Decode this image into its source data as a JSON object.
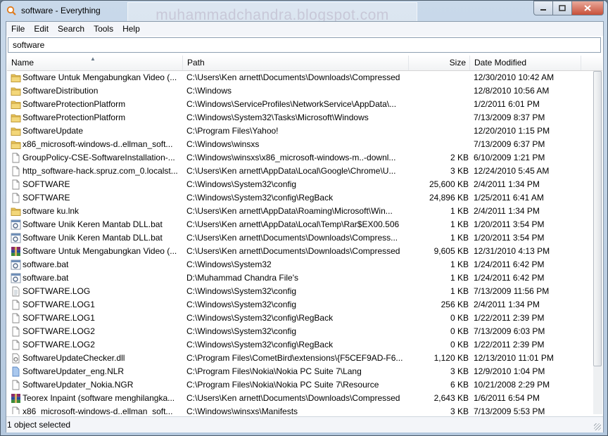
{
  "window": {
    "title": "software - Everything",
    "watermark": "muhammadchandra.blogspot.com",
    "controls": [
      "minimize",
      "maximize",
      "close"
    ]
  },
  "menu": [
    "File",
    "Edit",
    "Search",
    "Tools",
    "Help"
  ],
  "search": {
    "value": "software"
  },
  "columns": {
    "name": "Name",
    "path": "Path",
    "size": "Size",
    "date": "Date Modified"
  },
  "rows": [
    {
      "icon": "folder",
      "name": "Software Untuk Mengabungkan Video (...",
      "path": "C:\\Users\\Ken arnett\\Documents\\Downloads\\Compressed",
      "size": "",
      "date": "12/30/2010 10:42 AM"
    },
    {
      "icon": "folder",
      "name": "SoftwareDistribution",
      "path": "C:\\Windows",
      "size": "",
      "date": "12/8/2010 10:56 AM"
    },
    {
      "icon": "folder",
      "name": "SoftwareProtectionPlatform",
      "path": "C:\\Windows\\ServiceProfiles\\NetworkService\\AppData\\...",
      "size": "",
      "date": "1/2/2011 6:01 PM"
    },
    {
      "icon": "folder",
      "name": "SoftwareProtectionPlatform",
      "path": "C:\\Windows\\System32\\Tasks\\Microsoft\\Windows",
      "size": "",
      "date": "7/13/2009 8:37 PM"
    },
    {
      "icon": "folder",
      "name": "SoftwareUpdate",
      "path": "C:\\Program Files\\Yahoo!",
      "size": "",
      "date": "12/20/2010 1:15 PM"
    },
    {
      "icon": "folder",
      "name": "x86_microsoft-windows-d..ellman_soft...",
      "path": "C:\\Windows\\winsxs",
      "size": "",
      "date": "7/13/2009 6:37 PM"
    },
    {
      "icon": "file",
      "name": "GroupPolicy-CSE-SoftwareInstallation-...",
      "path": "C:\\Windows\\winsxs\\x86_microsoft-windows-m..-downl...",
      "size": "2 KB",
      "date": "6/10/2009 1:21 PM"
    },
    {
      "icon": "file",
      "name": "http_software-hack.spruz.com_0.localst...",
      "path": "C:\\Users\\Ken arnett\\AppData\\Local\\Google\\Chrome\\U...",
      "size": "3 KB",
      "date": "12/24/2010 5:45 AM"
    },
    {
      "icon": "file",
      "name": "SOFTWARE",
      "path": "C:\\Windows\\System32\\config",
      "size": "25,600 KB",
      "date": "2/4/2011 1:34 PM"
    },
    {
      "icon": "file",
      "name": "SOFTWARE",
      "path": "C:\\Windows\\System32\\config\\RegBack",
      "size": "24,896 KB",
      "date": "1/25/2011 6:41 AM"
    },
    {
      "icon": "folder",
      "name": "software ku.lnk",
      "path": "C:\\Users\\Ken arnett\\AppData\\Roaming\\Microsoft\\Win...",
      "size": "1 KB",
      "date": "2/4/2011 1:34 PM"
    },
    {
      "icon": "bat",
      "name": "Software Unik Keren Mantab DLL.bat",
      "path": "C:\\Users\\Ken arnett\\AppData\\Local\\Temp\\Rar$EX00.506",
      "size": "1 KB",
      "date": "1/20/2011 3:54 PM"
    },
    {
      "icon": "bat",
      "name": "Software Unik Keren Mantab DLL.bat",
      "path": "C:\\Users\\Ken arnett\\Documents\\Downloads\\Compress...",
      "size": "1 KB",
      "date": "1/20/2011 3:54 PM"
    },
    {
      "icon": "rar",
      "name": "Software Untuk Mengabungkan Video (...",
      "path": "C:\\Users\\Ken arnett\\Documents\\Downloads\\Compressed",
      "size": "9,605 KB",
      "date": "12/31/2010 4:13 PM"
    },
    {
      "icon": "bat",
      "name": "software.bat",
      "path": "C:\\Windows\\System32",
      "size": "1 KB",
      "date": "1/24/2011 6:42 PM"
    },
    {
      "icon": "bat",
      "name": "software.bat",
      "path": "D:\\Muhammad Chandra File's",
      "size": "1 KB",
      "date": "1/24/2011 6:42 PM"
    },
    {
      "icon": "text",
      "name": "SOFTWARE.LOG",
      "path": "C:\\Windows\\System32\\config",
      "size": "1 KB",
      "date": "7/13/2009 11:56 PM"
    },
    {
      "icon": "file",
      "name": "SOFTWARE.LOG1",
      "path": "C:\\Windows\\System32\\config",
      "size": "256 KB",
      "date": "2/4/2011 1:34 PM"
    },
    {
      "icon": "file",
      "name": "SOFTWARE.LOG1",
      "path": "C:\\Windows\\System32\\config\\RegBack",
      "size": "0 KB",
      "date": "1/22/2011 2:39 PM"
    },
    {
      "icon": "file",
      "name": "SOFTWARE.LOG2",
      "path": "C:\\Windows\\System32\\config",
      "size": "0 KB",
      "date": "7/13/2009 6:03 PM"
    },
    {
      "icon": "file",
      "name": "SOFTWARE.LOG2",
      "path": "C:\\Windows\\System32\\config\\RegBack",
      "size": "0 KB",
      "date": "1/22/2011 2:39 PM"
    },
    {
      "icon": "dll",
      "name": "SoftwareUpdateChecker.dll",
      "path": "C:\\Program Files\\CometBird\\extensions\\{F5CEF9AD-F6...",
      "size": "1,120 KB",
      "date": "12/13/2010 11:01 PM"
    },
    {
      "icon": "nlr",
      "name": "SoftwareUpdater_eng.NLR",
      "path": "C:\\Program Files\\Nokia\\Nokia PC Suite 7\\Lang",
      "size": "3 KB",
      "date": "12/9/2010 1:04 PM"
    },
    {
      "icon": "file",
      "name": "SoftwareUpdater_Nokia.NGR",
      "path": "C:\\Program Files\\Nokia\\Nokia PC Suite 7\\Resource",
      "size": "6 KB",
      "date": "10/21/2008 2:29 PM"
    },
    {
      "icon": "rar",
      "name": "Teorex Inpaint (software menghilangka...",
      "path": "C:\\Users\\Ken arnett\\Documents\\Downloads\\Compressed",
      "size": "2,643 KB",
      "date": "1/6/2011 6:54 PM"
    },
    {
      "icon": "file",
      "name": "x86_microsoft-windows-d..ellman_soft...",
      "path": "C:\\Windows\\winsxs\\Manifests",
      "size": "3 KB",
      "date": "7/13/2009 5:53 PM"
    }
  ],
  "status": {
    "text": "1 object selected"
  }
}
